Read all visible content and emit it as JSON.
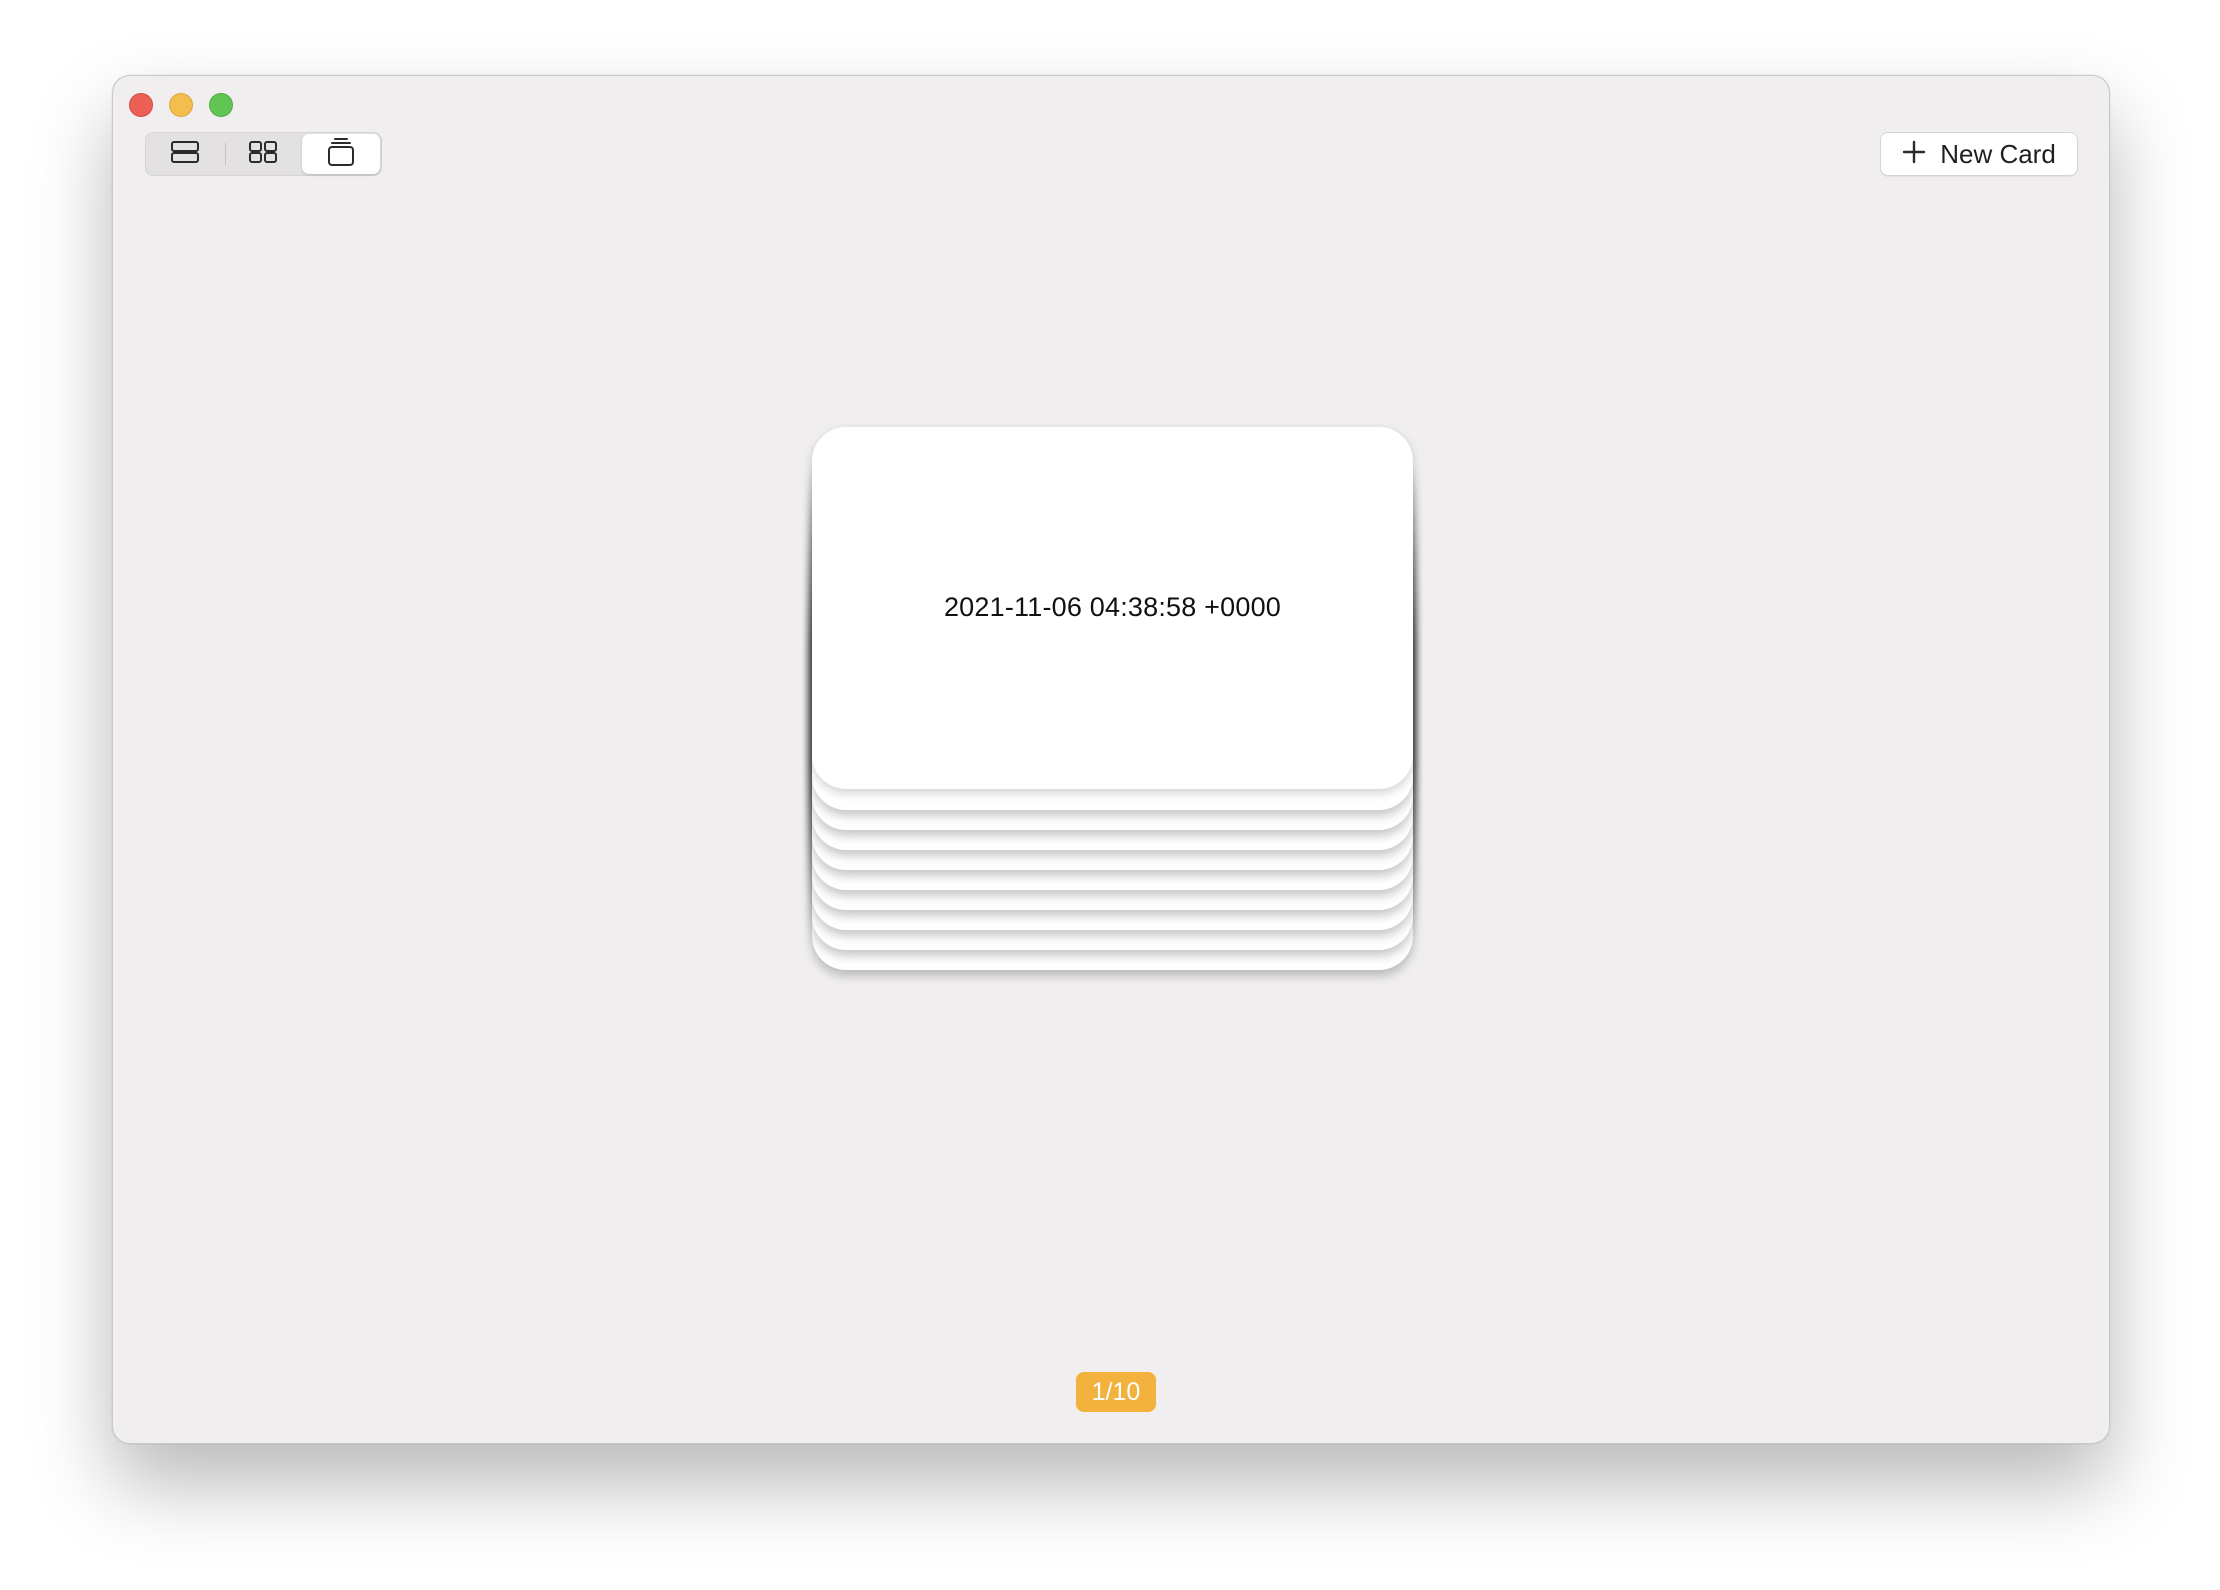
{
  "window": {
    "controls": [
      "close",
      "minimize",
      "zoom"
    ]
  },
  "toolbar": {
    "view_modes": [
      {
        "name": "list",
        "icon": "rows-icon",
        "active": false
      },
      {
        "name": "grid",
        "icon": "grid-icon",
        "active": false
      },
      {
        "name": "stack",
        "icon": "stack-icon",
        "active": true
      }
    ],
    "new_card_label": "New Card",
    "new_card_icon": "plus-icon"
  },
  "stack": {
    "front_card_text": "2021-11-06 04:38:58 +0000",
    "stacked_cards_visible": 9
  },
  "pager": {
    "label": "1/10",
    "color": "#f2b23d"
  },
  "colors": {
    "window_background": "#f0eeef",
    "close": "#ec5f57",
    "minimize": "#f4be4f",
    "zoom": "#61c554"
  }
}
